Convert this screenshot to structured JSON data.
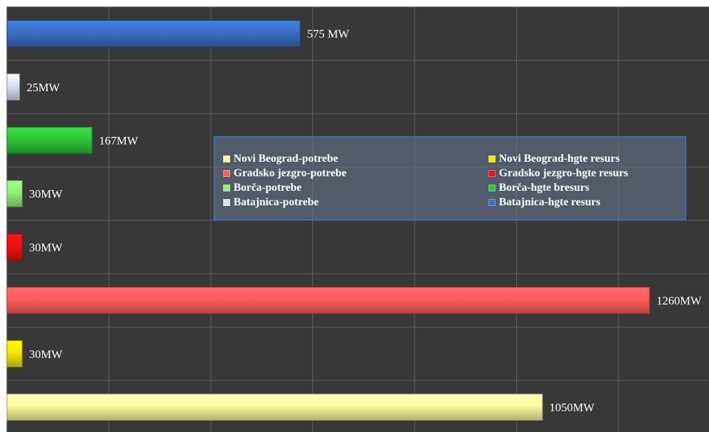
{
  "chart_data": {
    "type": "bar",
    "orientation": "horizontal",
    "grid": true,
    "background": "#383838",
    "xlim": [
      0,
      1320
    ],
    "bars": [
      {
        "series": "Batajnica-hgte resurs",
        "value": 575,
        "label": "575 MW",
        "color": "#3a6fc4"
      },
      {
        "series": "Batajnica-potrebe",
        "value": 25,
        "label": "25MW",
        "color": "#d9e2f1"
      },
      {
        "series": "Borča-hgte bresurs",
        "value": 167,
        "label": "167MW",
        "color": "#2fc43a"
      },
      {
        "series": "Borča-potrebe",
        "value": 30,
        "label": "30MW",
        "color": "#8ff07a"
      },
      {
        "series": "Gradsko jezgro-hgte resurs",
        "value": 30,
        "label": "30MW",
        "color": "#ee1111"
      },
      {
        "series": "Gradsko jezgro-potrebe",
        "value": 1260,
        "label": "1260MW",
        "color": "#ff5c5c"
      },
      {
        "series": "Novi Beograd-hgte resurs",
        "value": 30,
        "label": "30MW",
        "color": "#f5e50a"
      },
      {
        "series": "Novi Beograd-potrebe",
        "value": 1050,
        "label": "1050MW",
        "color": "#fafaa0"
      }
    ],
    "legend": {
      "placement": "center",
      "items": [
        {
          "label": "Novi Beograd-potrebe",
          "color": "#fafaa0"
        },
        {
          "label": "Gradsko jezgro-potrebe",
          "color": "#ff5c5c"
        },
        {
          "label": "Borča-potrebe",
          "color": "#8ff07a"
        },
        {
          "label": "Batajnica-potrebe",
          "color": "#d9e2f1"
        },
        {
          "label": "Novi Beograd-hgte resurs",
          "color": "#f5e50a"
        },
        {
          "label": "Gradsko jezgro-hgte resurs",
          "color": "#ee1111"
        },
        {
          "label": "Borča-hgte bresurs",
          "color": "#2fc43a"
        },
        {
          "label": "Batajnica-hgte resurs",
          "color": "#3a6fc4"
        }
      ]
    }
  }
}
